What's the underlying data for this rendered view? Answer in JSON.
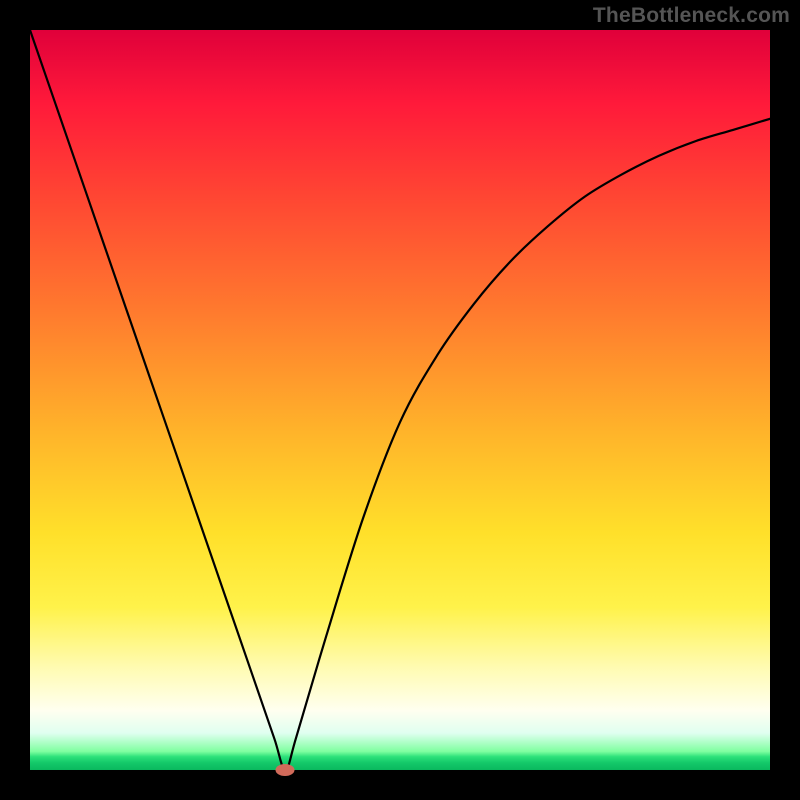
{
  "attribution": "TheBottleneck.com",
  "colors": {
    "frame": "#000000",
    "curve": "#000000",
    "dot": "#d16a5a",
    "gradient_stops": [
      "#e0003a",
      "#ff1a3a",
      "#ff4433",
      "#ff7a2e",
      "#ffb62a",
      "#ffe02a",
      "#fff24a",
      "#fffbb0",
      "#fffff0",
      "#e0fff0",
      "#7fffa0",
      "#2de27a",
      "#14c96a",
      "#0ab85e"
    ]
  },
  "chart_data": {
    "type": "line",
    "title": "",
    "xlabel": "",
    "ylabel": "",
    "xlim": [
      0,
      1
    ],
    "ylim": [
      0,
      1
    ],
    "minimum": {
      "x": 0.345,
      "y": 0.0
    },
    "series": [
      {
        "name": "bottleneck-curve",
        "x": [
          0.0,
          0.05,
          0.1,
          0.15,
          0.2,
          0.25,
          0.3,
          0.33,
          0.345,
          0.36,
          0.4,
          0.45,
          0.5,
          0.55,
          0.6,
          0.65,
          0.7,
          0.75,
          0.8,
          0.85,
          0.9,
          0.95,
          1.0
        ],
        "y": [
          1.0,
          0.855,
          0.71,
          0.565,
          0.42,
          0.275,
          0.13,
          0.043,
          0.0,
          0.045,
          0.18,
          0.34,
          0.47,
          0.56,
          0.63,
          0.688,
          0.735,
          0.775,
          0.805,
          0.83,
          0.85,
          0.865,
          0.88
        ]
      }
    ],
    "marker": {
      "x": 0.345,
      "y": 0.0,
      "color": "#d16a5a"
    }
  }
}
